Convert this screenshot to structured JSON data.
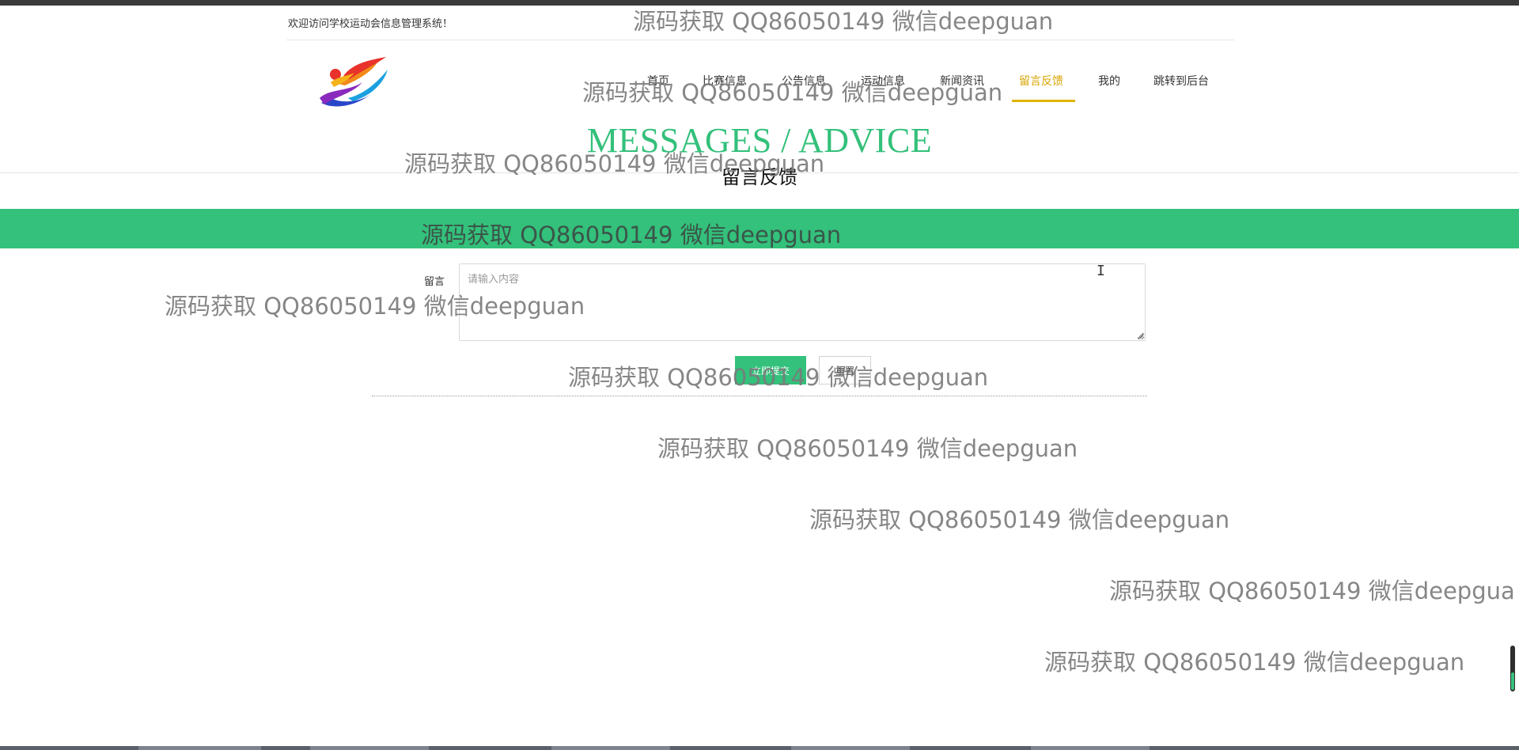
{
  "header": {
    "welcome": "欢迎访问学校运动会信息管理系统！"
  },
  "logo_alt": "school-sports-logo",
  "nav": {
    "items": [
      {
        "label": "首页"
      },
      {
        "label": "比赛信息"
      },
      {
        "label": "公告信息"
      },
      {
        "label": "运动信息"
      },
      {
        "label": "新闻资讯"
      },
      {
        "label": "留言反馈"
      },
      {
        "label": "我的"
      },
      {
        "label": "跳转到后台"
      }
    ],
    "active_index": 5
  },
  "page": {
    "title_en": "MESSAGES / ADVICE",
    "title_cn": "留言反馈"
  },
  "form": {
    "message_label": "留言",
    "message_placeholder": "请输入内容",
    "message_value": "",
    "submit_label": "立即提交",
    "reset_label": "重置"
  },
  "watermark": {
    "text": "源码获取 QQ86050149 微信deepguan",
    "text_clipped": "源码获取 QQ86050149 微信deepgua"
  },
  "colors": {
    "accent_green": "#33c17b",
    "active_nav": "#d9a400",
    "watermark_gray": "#7a7a7a"
  }
}
